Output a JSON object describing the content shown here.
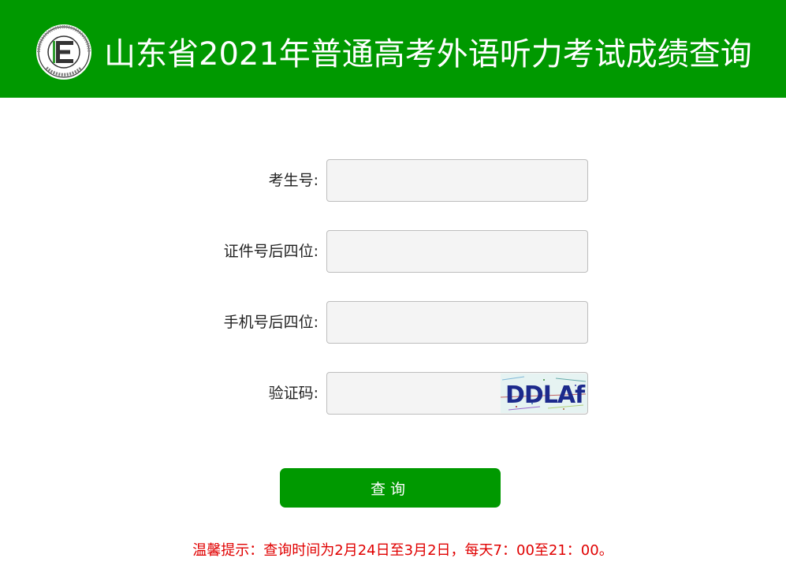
{
  "header": {
    "title": "山东省2021年普通高考外语听力考试成绩查询",
    "logo_icon": "education-exam-seal-icon",
    "logo_letter": "E",
    "background_color": "#009900"
  },
  "form": {
    "fields": [
      {
        "label": "考生号:",
        "value": "",
        "placeholder": ""
      },
      {
        "label": "证件号后四位:",
        "value": "",
        "placeholder": ""
      },
      {
        "label": "手机号后四位:",
        "value": "",
        "placeholder": ""
      },
      {
        "label": "验证码:",
        "value": "",
        "placeholder": ""
      }
    ],
    "captcha": {
      "text": "DDLAf",
      "icon": "captcha-image"
    },
    "submit_label": "查询"
  },
  "notice": "温馨提示：查询时间为2月24日至3月2日，每天7：00至21：00。",
  "colors": {
    "primary": "#009900",
    "notice": "#e00000",
    "input_bg": "#f4f4f4"
  }
}
